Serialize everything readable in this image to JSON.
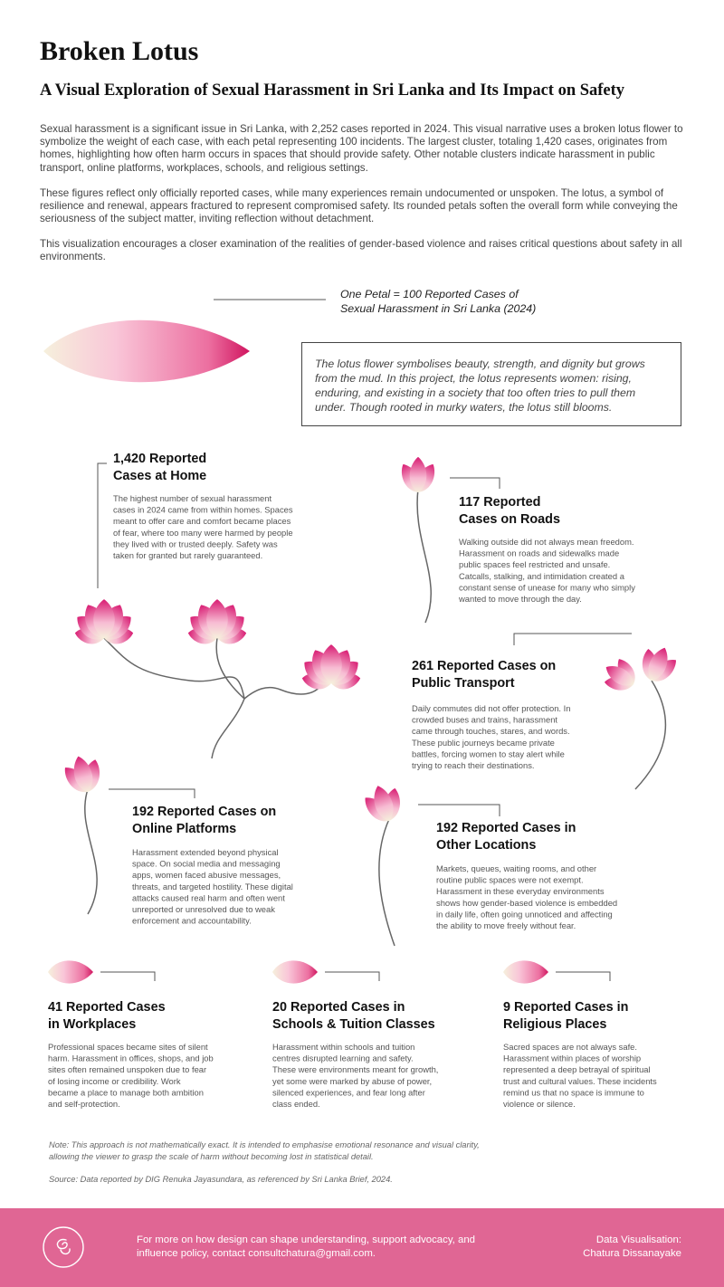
{
  "title": "Broken Lotus",
  "subtitle": "A Visual Exploration of Sexual Harassment in Sri Lanka and Its Impact on Safety",
  "intro": [
    "Sexual harassment is a significant issue in Sri Lanka, with 2,252 cases reported in 2024. This visual narrative uses a broken lotus flower to symbolize the weight of each case, with each petal representing 100 incidents. The largest cluster, totaling 1,420 cases, originates from homes, highlighting how often harm occurs in spaces that should provide safety. Other notable clusters indicate harassment in public transport, online platforms, workplaces, schools, and religious settings.",
    "These figures reflect only officially reported cases, while many experiences remain undocumented or unspoken. The lotus, a symbol of resilience and renewal, appears fractured to represent compromised safety. Its rounded petals soften the overall form while conveying the seriousness of the subject matter, inviting reflection without detachment.",
    "This visualization encourages a closer examination of the realities of gender-based violence and raises critical questions about safety in all environments."
  ],
  "legend": {
    "line1": "One Petal = 100 Reported Cases of",
    "line2": "Sexual Harassment in Sri Lanka (2024)"
  },
  "quote": "The lotus flower symbolises beauty, strength, and dignity but grows from the mud. In this project, the lotus represents women: rising, enduring, and existing in a society that too often tries to pull them under. Though rooted in murky waters, the lotus still blooms.",
  "chart_data": {
    "type": "pictograph",
    "unit": "One Petal = 100 Reported Cases of Sexual Harassment in Sri Lanka (2024)",
    "total": 2252,
    "categories": [
      {
        "key": "home",
        "heading": [
          "1,420 Reported",
          "Cases at Home"
        ],
        "value": 1420,
        "petals": 14.2,
        "body": [
          "The highest number of sexual harassment",
          "cases in 2024 came from within homes. Spaces",
          "meant to offer care and comfort became places",
          "of fear, where too many were harmed by people",
          "they lived with or trusted deeply. Safety was",
          "taken for granted but rarely guaranteed."
        ]
      },
      {
        "key": "roads",
        "heading": [
          "117 Reported",
          "Cases on Roads"
        ],
        "value": 117,
        "petals": 1.17,
        "body": [
          "Walking outside did not always mean freedom.",
          "Harassment on roads and sidewalks made",
          "public spaces feel restricted and unsafe.",
          "Catcalls, stalking, and intimidation created a",
          "constant sense of unease for many who simply",
          "wanted to move through the day."
        ]
      },
      {
        "key": "transport",
        "heading": [
          "261 Reported Cases on",
          "Public Transport"
        ],
        "value": 261,
        "petals": 2.61,
        "body": [
          "Daily commutes did not offer protection. In",
          "crowded buses and trains, harassment",
          "came through touches, stares, and words.",
          "These public journeys became private",
          "battles, forcing women to stay alert while",
          "trying to reach their destinations."
        ]
      },
      {
        "key": "online",
        "heading": [
          "192 Reported Cases on",
          "Online Platforms"
        ],
        "value": 192,
        "petals": 1.92,
        "body": [
          "Harassment extended beyond physical",
          "space. On social media and messaging",
          "apps, women faced abusive messages,",
          "threats, and targeted hostility. These digital",
          "attacks caused real harm and often went",
          "unreported or unresolved due to weak",
          "enforcement and accountability."
        ]
      },
      {
        "key": "other",
        "heading": [
          "192 Reported Cases in",
          "Other Locations"
        ],
        "value": 192,
        "petals": 1.92,
        "body": [
          "Markets, queues, waiting rooms, and other",
          "routine public spaces were not exempt.",
          "Harassment in these everyday environments",
          "shows how gender-based violence is embedded",
          "in daily life, often going unnoticed and affecting",
          "the ability to move freely without fear."
        ]
      },
      {
        "key": "work",
        "heading": [
          "41 Reported Cases",
          "in Workplaces"
        ],
        "value": 41,
        "petals": 0.41,
        "body": [
          "Professional spaces became sites of silent",
          "harm. Harassment in offices, shops, and job",
          "sites often remained unspoken due to fear",
          "of losing income or credibility. Work",
          "became a place to manage both ambition",
          "and self-protection."
        ]
      },
      {
        "key": "schools",
        "heading": [
          "20 Reported Cases in",
          "Schools & Tuition Classes"
        ],
        "value": 20,
        "petals": 0.2,
        "body": [
          "Harassment within schools and tuition",
          "centres disrupted learning and safety.",
          "These were environments meant for growth,",
          "yet some were marked by abuse of power,",
          "silenced experiences, and fear long after",
          "class ended."
        ]
      },
      {
        "key": "religious",
        "heading": [
          "9 Reported Cases in",
          "Religious Places"
        ],
        "value": 9,
        "petals": 0.09,
        "body": [
          "Sacred spaces are not always safe.",
          "Harassment within places of worship",
          "represented a deep betrayal of spiritual",
          "trust and cultural values. These incidents",
          "remind us that no space is immune to",
          "violence or silence."
        ]
      }
    ]
  },
  "note": "Note: This approach is not mathematically exact. It is intended to emphasise emotional resonance and visual clarity, allowing the viewer to grasp the scale of harm without becoming lost in statistical detail.",
  "source": "Source: Data reported by DIG Renuka Jayasundara, as referenced by Sri Lanka Brief, 2024.",
  "footer": {
    "text": "For more on how design can shape understanding, support advocacy, and influence policy, contact consultchatura@gmail.com.",
    "credit_line1": "Data Visualisation:",
    "credit_line2": "Chatura Dissanayake",
    "background": "#e06694"
  },
  "colors": {
    "petal_tip": "#d81b72",
    "petal_mid": "#f7aac7",
    "petal_base": "#f6f0dc",
    "stem": "#666666"
  }
}
